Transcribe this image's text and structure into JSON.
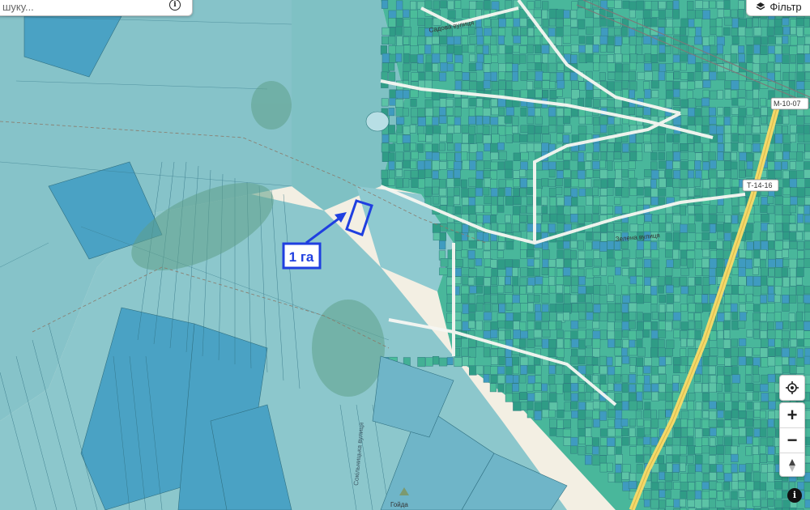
{
  "search": {
    "placeholder": "шуку..."
  },
  "filter": {
    "label": "Фільтр",
    "icon": "layers-icon"
  },
  "annotation": {
    "label": "1 га",
    "color": "#1f3fe0"
  },
  "road_shields": {
    "m10": "М-10-07",
    "t1416": "Т-14-16"
  },
  "street_labels": {
    "sadova": "Садова вулиця",
    "zelena": "Зелена вулиця",
    "sokilnytska": "Сокільницька вулиця",
    "hoida": "Гойда"
  },
  "colors": {
    "parcel_main": "#7fbfc7",
    "parcel_green": "#4bbd9a",
    "parcel_blue": "#3f9bc0",
    "forest": "#6aa98a",
    "road_yellow": "#f2d96a",
    "background": "#f3efe3"
  },
  "controls": {
    "geolocate_icon": "geolocate-icon",
    "zoom_in": "+",
    "zoom_out": "−",
    "compass": "▲",
    "info": "i"
  }
}
